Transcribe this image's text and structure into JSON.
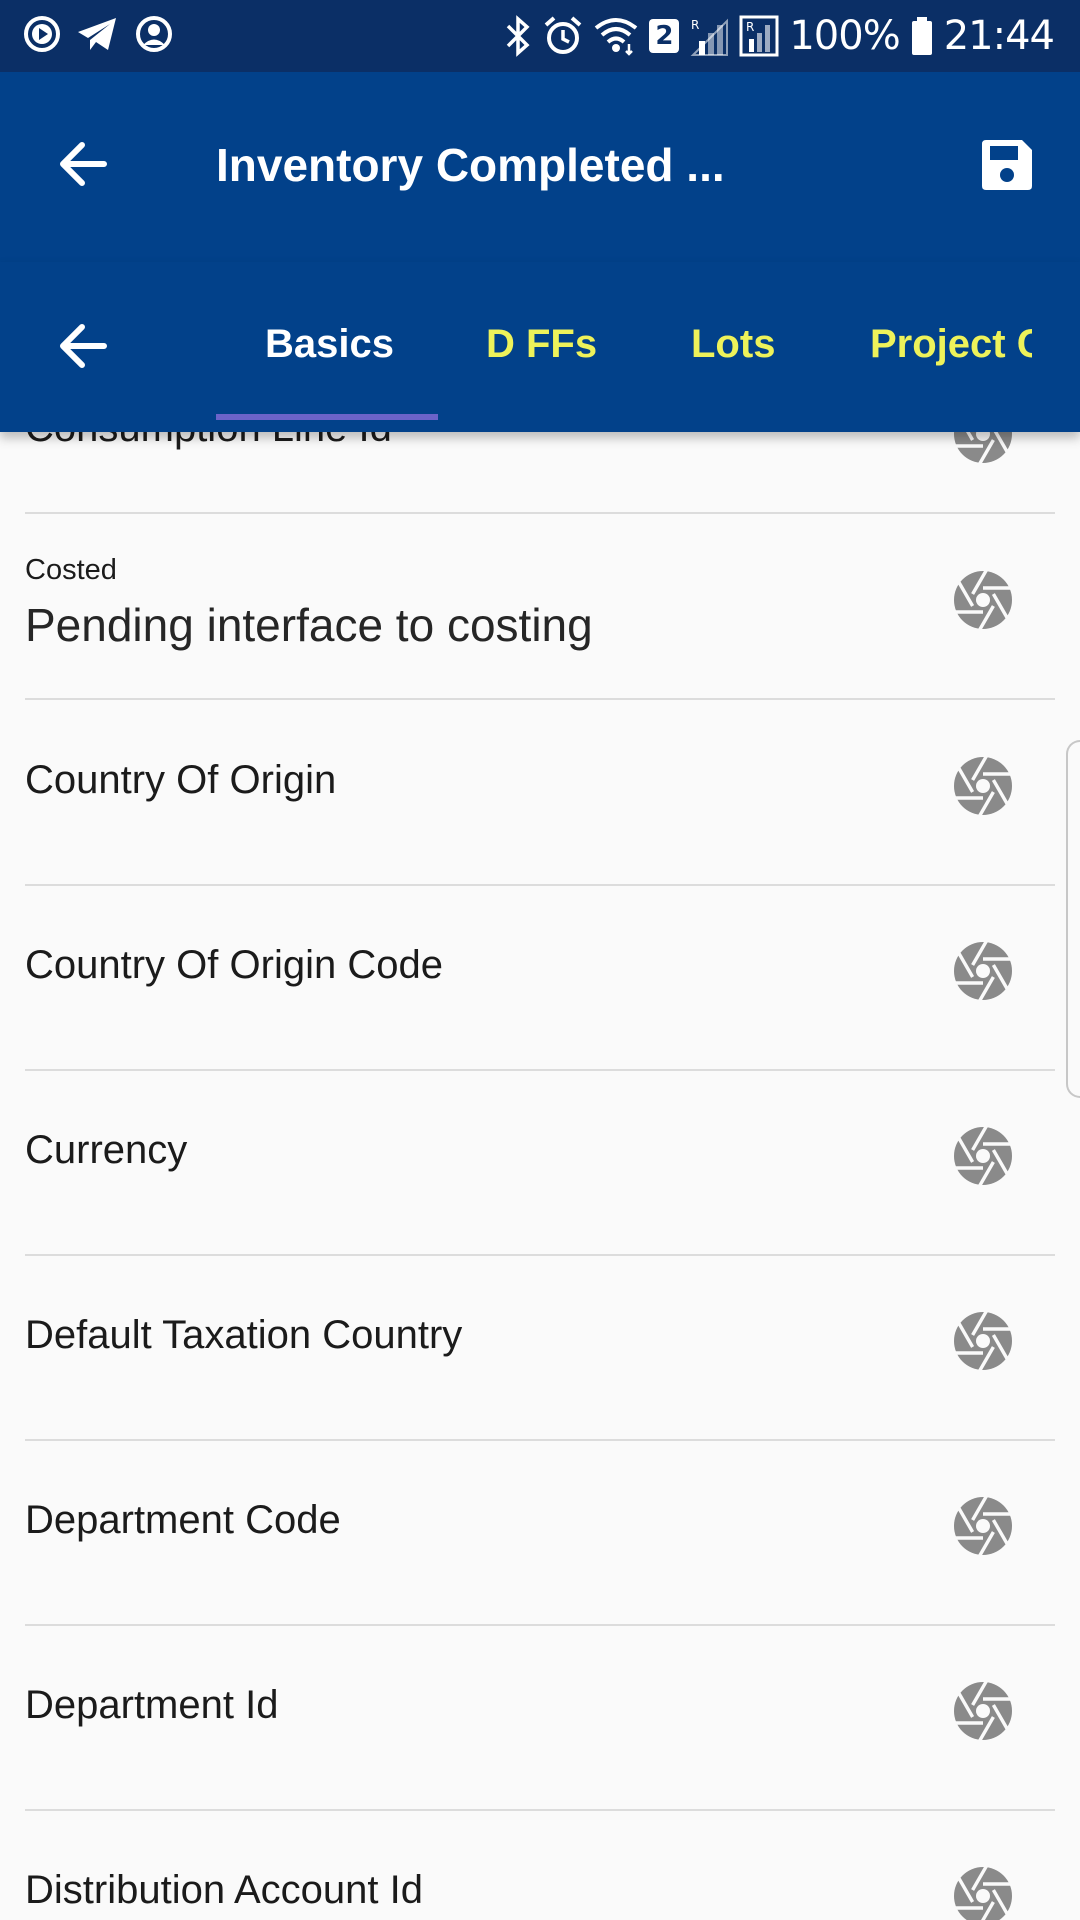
{
  "status_bar": {
    "icons_left": [
      "media-play-icon",
      "telegram-icon",
      "account-icon"
    ],
    "icons_right": [
      "bluetooth-icon",
      "alarm-icon",
      "wifi-icon",
      "sim-signal-icon",
      "roaming-signal-icon",
      "battery-icon"
    ],
    "sim_badge": "2",
    "battery": "100%",
    "time": "21:44"
  },
  "app_bar": {
    "title": "Inventory Completed ...",
    "back_icon": "arrow-left-icon",
    "save_icon": "floppy-disk-icon"
  },
  "tabs": {
    "back_icon": "arrow-left-icon",
    "items": [
      {
        "label": "Basics",
        "active": true
      },
      {
        "label": "D FFs",
        "active": false
      },
      {
        "label": "Lots",
        "active": false
      },
      {
        "label": "Project C",
        "active": false
      }
    ],
    "active_color": "#ffffff",
    "inactive_color": "#eef25a",
    "indicator_color": "#6b63c9"
  },
  "list": {
    "rows": [
      {
        "label": "Consumption Line Id"
      },
      {
        "label": "Costed",
        "value": "Pending interface to costing"
      },
      {
        "label": "Country Of Origin"
      },
      {
        "label": "Country Of Origin Code"
      },
      {
        "label": "Currency"
      },
      {
        "label": "Default Taxation Country"
      },
      {
        "label": "Department Code"
      },
      {
        "label": "Department Id"
      },
      {
        "label": "Distribution Account Id"
      }
    ],
    "row_icon": "camera-aperture-icon"
  },
  "colors": {
    "status_bar": "#0b2f66",
    "app_bar": "#02418a",
    "background": "#fafafa",
    "icon_gray": "#8a8a8a"
  }
}
